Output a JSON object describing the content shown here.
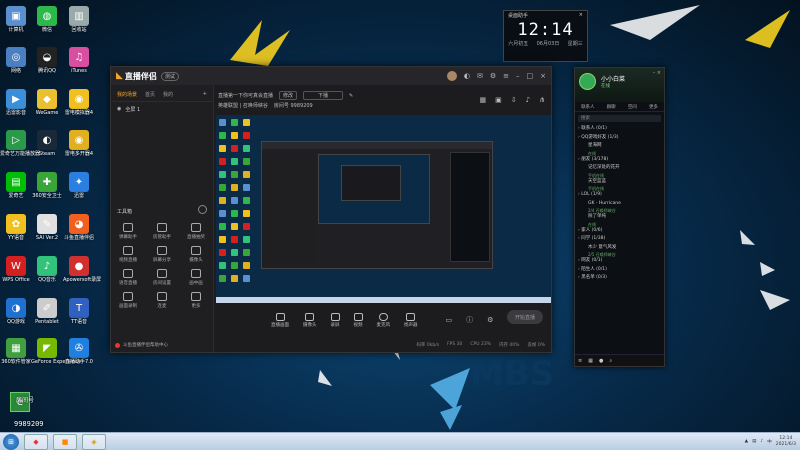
{
  "desktop": {
    "icons": [
      {
        "label": "计算机",
        "icon": "computer-icon",
        "color": "#5a8fd0"
      },
      {
        "label": "微信",
        "icon": "wechat-icon",
        "color": "#2db84c"
      },
      {
        "label": "回收站",
        "icon": "recycle-bin-icon",
        "color": "#9aa"
      },
      {
        "label": "网络",
        "icon": "network-icon",
        "color": "#4a7fc0"
      },
      {
        "label": "腾讯QQ",
        "icon": "qq-icon",
        "color": "#222"
      },
      {
        "label": "iTunes",
        "icon": "itunes-icon",
        "color": "#d84ea0"
      },
      {
        "label": "迅雷影音",
        "icon": "xunlei-icon",
        "color": "#3a8fd8"
      },
      {
        "label": "WeGame",
        "icon": "wegame-icon",
        "color": "#e8c030"
      },
      {
        "label": "雷电模拟器4",
        "icon": "ldplayer-icon",
        "color": "#f0c020"
      },
      {
        "label": "爱奇艺万能播放器",
        "icon": "iqiyi-player-icon",
        "color": "#2a9a4a"
      },
      {
        "label": "Steam",
        "icon": "steam-icon",
        "color": "#1b2838"
      },
      {
        "label": "雷电多开器4",
        "icon": "ld-multi-icon",
        "color": "#e0b020"
      },
      {
        "label": "爱奇艺",
        "icon": "iqiyi-icon",
        "color": "#00be06"
      },
      {
        "label": "360安全卫士",
        "icon": "360-safe-icon",
        "color": "#3aa63a"
      },
      {
        "label": "迅雷",
        "icon": "xunlei-bird-icon",
        "color": "#2a7fe0"
      },
      {
        "label": "YY语音",
        "icon": "yy-icon",
        "color": "#f0c020"
      },
      {
        "label": "SAI Ver.2",
        "icon": "sai-icon",
        "color": "#e0e0e0"
      },
      {
        "label": "斗鱼直播伴侣",
        "icon": "douyu-icon",
        "color": "#f06020"
      },
      {
        "label": "WPS Office",
        "icon": "wps-icon",
        "color": "#d42020"
      },
      {
        "label": "QQ音乐",
        "icon": "qqmusic-icon",
        "color": "#31c27c"
      },
      {
        "label": "Apowersoft录屏",
        "icon": "apowerrec-icon",
        "color": "#d03030"
      },
      {
        "label": "QQ游戏",
        "icon": "qqgame-icon",
        "color": "#2070d0"
      },
      {
        "label": "Pentablet",
        "icon": "pentablet-icon",
        "color": "#ccc"
      },
      {
        "label": "TT语音",
        "icon": "tt-icon",
        "color": "#3060c0"
      },
      {
        "label": "360软件管家",
        "icon": "360-software-icon",
        "color": "#40a040"
      },
      {
        "label": "GeForce Experience",
        "icon": "geforce-icon",
        "color": "#76b900"
      },
      {
        "label": "直播助手7.0",
        "icon": "live-helper-icon",
        "color": "#2080e0"
      }
    ]
  },
  "clock_widget": {
    "header_left": "桌面助手",
    "time": "12:14",
    "date_left": "六月初五",
    "date_mid": "06月03日",
    "date_right": "星期三"
  },
  "main_window": {
    "app_name": "直播伴侣",
    "version": "测试",
    "left_tabs": [
      "我的场景",
      "首页",
      "我的"
    ],
    "scene_item": "全屏 1",
    "tools_title": "工具箱",
    "tools": [
      "弹幕助手",
      "房管助手",
      "直播抽奖",
      "视频直播",
      "屏幕分享",
      "摄像头",
      "语音直播",
      "房间设置",
      "画中画",
      "画面录制",
      "连麦",
      "更多"
    ],
    "tip": "斗鱼直播伴侣帮助中心",
    "stream_title": "直播第一下你可真会直播",
    "stream_tag": "修改",
    "stream_box": "下播",
    "category": "英雄联盟 | 召唤师峡谷",
    "room_info": "房间号 9989209",
    "bottom_buttons": [
      "直播画面",
      "摄像头",
      "录屏",
      "视频",
      "麦克风",
      "扬声器"
    ],
    "live_label": "开始直播",
    "status_items": [
      "码率 0kb/s",
      "FPS 30",
      "CPU 23%",
      "内存 40%",
      "丢帧 0%"
    ]
  },
  "qq_window": {
    "nickname": "小小白菜",
    "status": "在线",
    "tabs": [
      "联系人",
      "群聊",
      "空间",
      "更多"
    ],
    "search_placeholder": "搜索",
    "list": [
      {
        "type": "grp",
        "text": "联系人 (0/1)"
      },
      {
        "type": "grp",
        "text": "QQ游戏好友 (1/3)"
      },
      {
        "type": "fr",
        "text": "星海网"
      },
      {
        "type": "sub",
        "text": "在线"
      },
      {
        "type": "grp",
        "text": "朋友 (3/178)"
      },
      {
        "type": "fr",
        "text": "记忆深处的花开"
      },
      {
        "type": "sub",
        "text": "手机在线"
      },
      {
        "type": "fr",
        "text": "天空蓝蓝"
      },
      {
        "type": "sub",
        "text": "手机在线"
      },
      {
        "type": "grp",
        "text": "LOL (1/9)"
      },
      {
        "type": "fr",
        "text": "GK - Hurricane"
      },
      {
        "type": "sub",
        "text": "2/4 召唤师峡谷"
      },
      {
        "type": "fr",
        "text": "除了单纯"
      },
      {
        "type": "sub",
        "text": "在线"
      },
      {
        "type": "grp",
        "text": "家人 (0/6)"
      },
      {
        "type": "grp",
        "text": "同学 (1/38)"
      },
      {
        "type": "fr",
        "text": "木少 意气风发"
      },
      {
        "type": "sub",
        "text": "2/5 召唤师峡谷"
      },
      {
        "type": "grp",
        "text": "网友 (0/1)"
      },
      {
        "type": "grp",
        "text": "陌生人 (0/1)"
      },
      {
        "type": "grp",
        "text": "黑名单 (0/3)"
      }
    ]
  },
  "corner_badge": {
    "label": "房间号",
    "number": "9989209"
  },
  "taskbar": {
    "time": "12:14",
    "date": "2021/6/3",
    "lang": "中"
  }
}
